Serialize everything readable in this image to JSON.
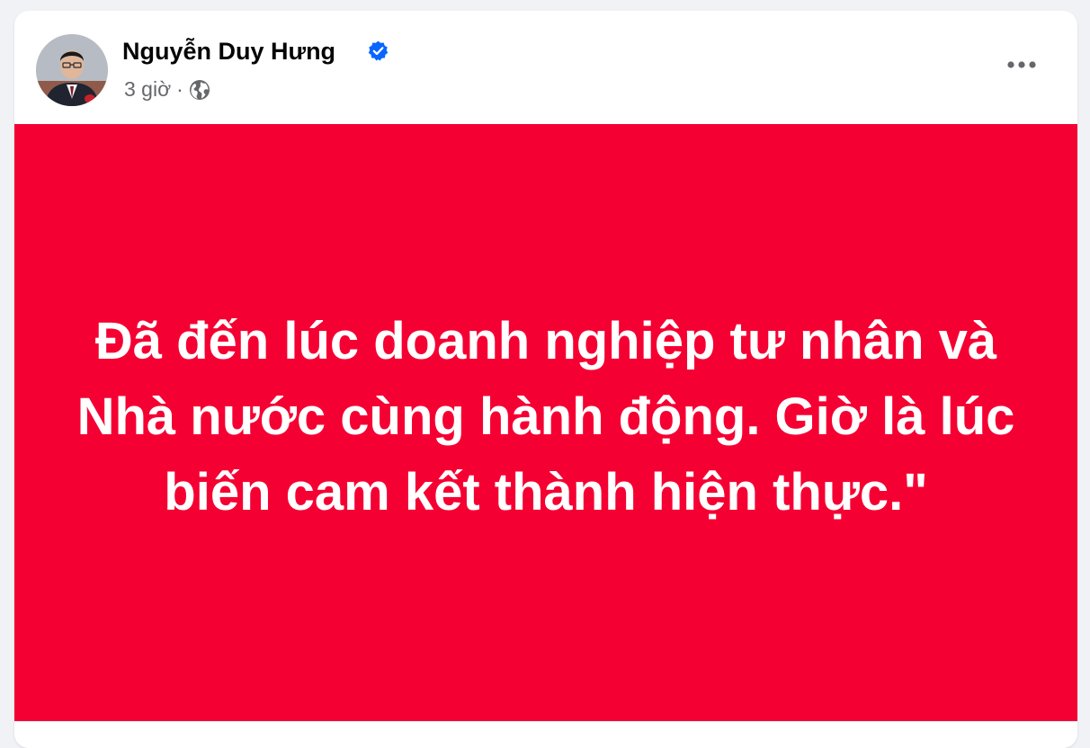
{
  "post": {
    "author": {
      "name": "Nguyễn Duy Hưng",
      "verified_icon": "verified-badge-icon",
      "avatar_icon": "avatar-photo"
    },
    "meta": {
      "time": "3 giờ",
      "separator": "·",
      "privacy_icon": "globe-icon"
    },
    "more_icon": "more-options-icon",
    "body": {
      "lines": [
        "Đã đến lúc doanh nghiệp tư nhân và",
        "Nhà nước cùng hành động. Giờ là lúc",
        "biến cam kết thành hiện thực.\""
      ]
    }
  },
  "colors": {
    "page_background": "#f0f2f5",
    "card_background": "#ffffff",
    "post_background": "#f50032",
    "post_text": "#ffffff",
    "verified_blue": "#0866ff",
    "meta_gray": "#65676b",
    "name_text": "#050505"
  }
}
